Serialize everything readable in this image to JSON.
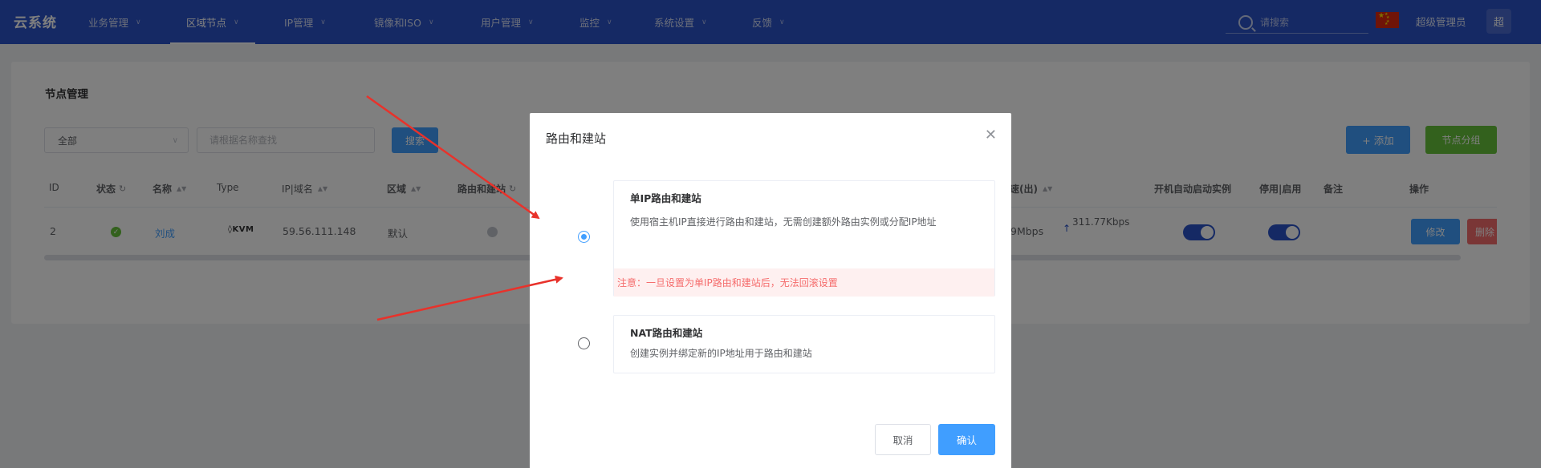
{
  "app": {
    "logo": "云系统"
  },
  "nav": {
    "items": [
      {
        "label": "业务管理"
      },
      {
        "label": "区域节点"
      },
      {
        "label": "IP管理"
      },
      {
        "label": "镜像和ISO"
      },
      {
        "label": "用户管理"
      },
      {
        "label": "监控"
      },
      {
        "label": "系统设置"
      },
      {
        "label": "反馈"
      }
    ],
    "search_placeholder": "请搜索",
    "user_name": "超级管理员",
    "avatar_text": "超"
  },
  "page": {
    "title": "节点管理",
    "filter_value": "全部",
    "keyword_placeholder": "请根据名称查找",
    "search_button": "搜索",
    "add_button": "+ 添加",
    "group_button": "节点分组"
  },
  "table": {
    "headers": {
      "id": "ID",
      "status": "状态",
      "name": "名称",
      "type": "Type",
      "ip": "IP|域名",
      "region": "区域",
      "route": "路由和建站",
      "speed": "速(出)",
      "autostart": "开机自动启动实例",
      "enable": "停用|启用",
      "remark": "备注",
      "ops": "操作"
    },
    "row": {
      "id": "2",
      "name": "刘成",
      "type": "KVM",
      "ip": "59.56.111.148",
      "region": "默认",
      "speed_down": "9Mbps",
      "speed_up": "311.77Kbps",
      "edit": "修改",
      "delete": "删除"
    }
  },
  "dialog": {
    "title": "路由和建站",
    "options": [
      {
        "title": "单IP路由和建站",
        "desc": "使用宿主机IP直接进行路由和建站，无需创建额外路由实例或分配IP地址",
        "warning": "注意：一旦设置为单IP路由和建站后，无法回滚设置",
        "selected": true
      },
      {
        "title": "NAT路由和建站",
        "desc": "创建实例并绑定新的IP地址用于路由和建站",
        "selected": false
      }
    ],
    "cancel": "取消",
    "confirm": "确认"
  },
  "colors": {
    "nav_bg": "#2a52c9",
    "primary": "#409eff",
    "success": "#67c23a",
    "danger": "#f56c6c",
    "annotation_arrow": "#e8322b"
  }
}
